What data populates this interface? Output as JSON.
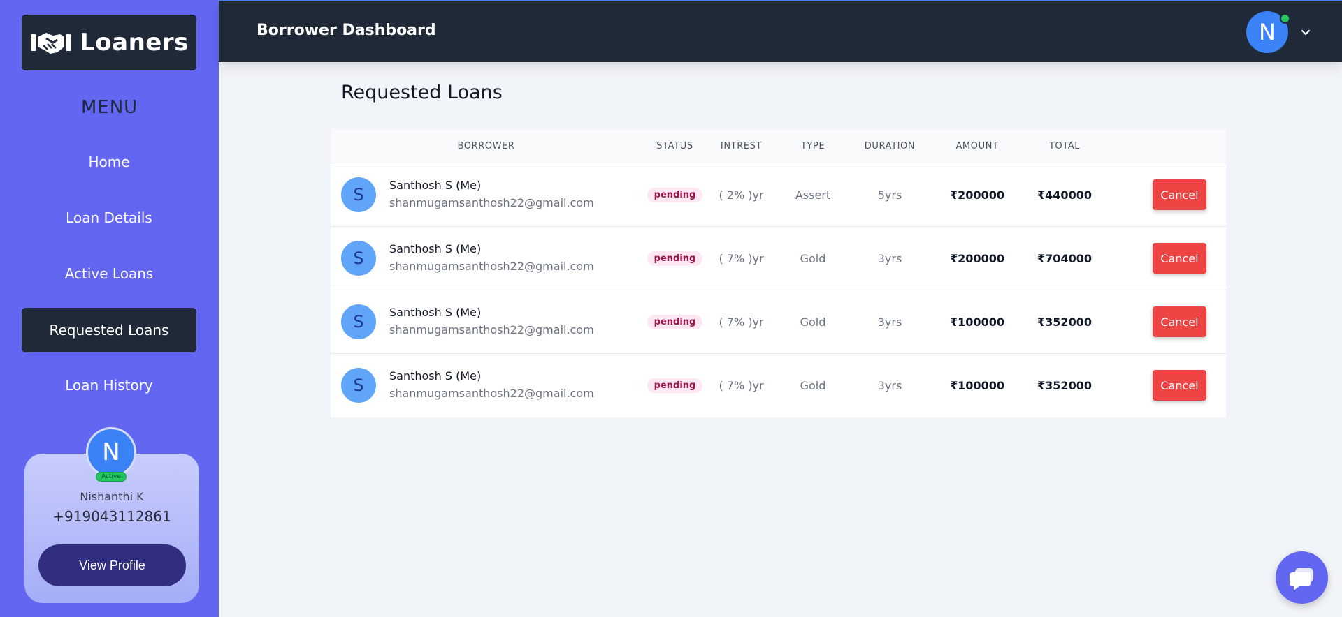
{
  "brand": {
    "name": "Loaners"
  },
  "sidebar": {
    "menu_title": "MENU",
    "items": [
      {
        "label": "Home"
      },
      {
        "label": "Loan Details"
      },
      {
        "label": "Active Loans"
      },
      {
        "label": "Requested Loans",
        "active": true
      },
      {
        "label": "Loan History"
      }
    ],
    "profile": {
      "initial": "N",
      "badge": "Active",
      "name": "Nishanthi K",
      "phone": "+919043112861",
      "button_label": "View Profile"
    }
  },
  "header": {
    "title": "Borrower Dashboard",
    "avatar_initial": "N",
    "online_color": "#22c55e"
  },
  "main": {
    "page_title": "Requested Loans",
    "table": {
      "columns": [
        "BORROWER",
        "STATUS",
        "INTREST",
        "TYPE",
        "DURATION",
        "AMOUNT",
        "TOTAL"
      ],
      "rows": [
        {
          "initial": "S",
          "name": "Santhosh S (Me)",
          "email": "shanmugamsanthosh22@gmail.com",
          "status": "pending",
          "interest": "( 2% )yr",
          "type": "Assert",
          "duration": "5yrs",
          "amount": "₹200000",
          "total": "₹440000",
          "action": "Cancel"
        },
        {
          "initial": "S",
          "name": "Santhosh S (Me)",
          "email": "shanmugamsanthosh22@gmail.com",
          "status": "pending",
          "interest": "( 7% )yr",
          "type": "Gold",
          "duration": "3yrs",
          "amount": "₹200000",
          "total": "₹704000",
          "action": "Cancel"
        },
        {
          "initial": "S",
          "name": "Santhosh S (Me)",
          "email": "shanmugamsanthosh22@gmail.com",
          "status": "pending",
          "interest": "( 7% )yr",
          "type": "Gold",
          "duration": "3yrs",
          "amount": "₹100000",
          "total": "₹352000",
          "action": "Cancel"
        },
        {
          "initial": "S",
          "name": "Santhosh S (Me)",
          "email": "shanmugamsanthosh22@gmail.com",
          "status": "pending",
          "interest": "( 7% )yr",
          "type": "Gold",
          "duration": "3yrs",
          "amount": "₹100000",
          "total": "₹352000",
          "action": "Cancel"
        }
      ]
    }
  },
  "colors": {
    "sidebar": "#6366f1",
    "dark": "#1f2937",
    "cancel": "#ef4444",
    "status_bg": "#fce7f3"
  },
  "icons": {
    "logo": "handshake-icon",
    "chat": "chat-icon",
    "dropdown": "chevron-down-icon"
  }
}
